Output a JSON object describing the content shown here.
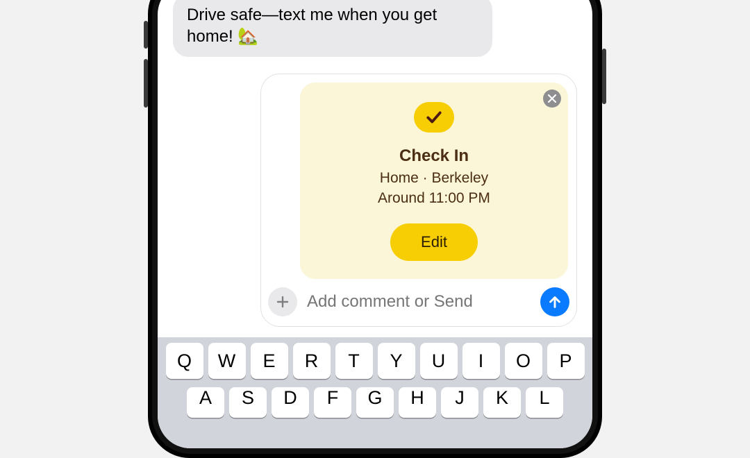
{
  "message": {
    "incoming_text": "Drive safe—text me when you get home! 🏡"
  },
  "checkin": {
    "title": "Check In",
    "location_line": "Home · Berkeley",
    "time_line": "Around 11:00 PM",
    "edit_label": "Edit"
  },
  "compose": {
    "placeholder": "Add comment or Send"
  },
  "keyboard": {
    "row1": [
      "Q",
      "W",
      "E",
      "R",
      "T",
      "Y",
      "U",
      "I",
      "O",
      "P"
    ],
    "row2": [
      "A",
      "S",
      "D",
      "F",
      "G",
      "H",
      "J",
      "K",
      "L"
    ]
  }
}
